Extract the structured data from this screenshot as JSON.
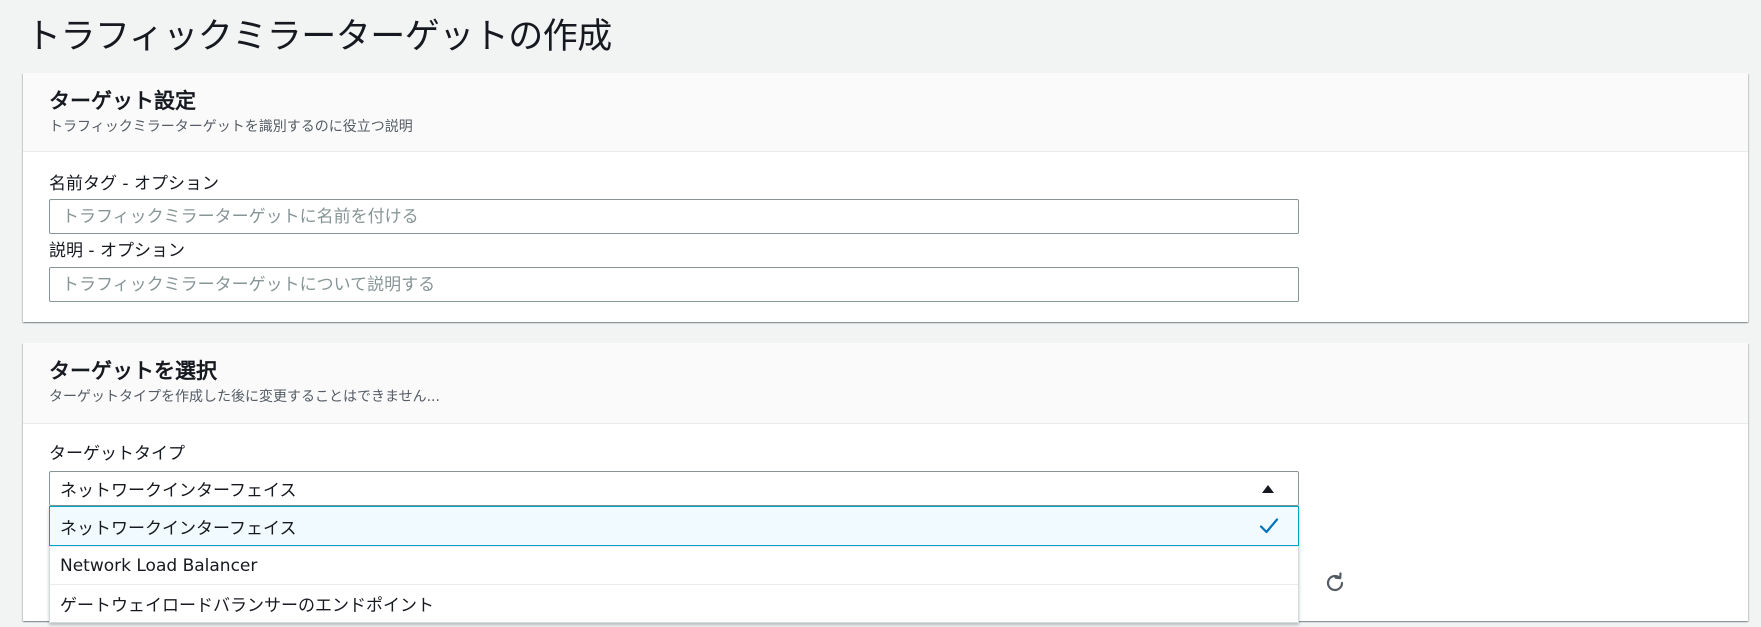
{
  "page": {
    "title": "トラフィックミラーターゲットの作成"
  },
  "target_settings": {
    "title": "ターゲット設定",
    "description": "トラフィックミラーターゲットを識別するのに役立つ説明",
    "name_tag": {
      "label": "名前タグ - オプション",
      "placeholder": "トラフィックミラーターゲットに名前を付ける",
      "value": ""
    },
    "description_field": {
      "label": "説明 - オプション",
      "placeholder": "トラフィックミラーターゲットについて説明する",
      "value": ""
    }
  },
  "select_target": {
    "title": "ターゲットを選択",
    "description": "ターゲットタイプを作成した後に変更することはできません...",
    "target_type": {
      "label": "ターゲットタイプ",
      "selected": "ネットワークインターフェイス",
      "options": [
        {
          "label": "ネットワークインターフェイス",
          "selected": true
        },
        {
          "label": "Network Load Balancer",
          "selected": false
        },
        {
          "label": "ゲートウェイロードバランサーのエンドポイント",
          "selected": false
        }
      ]
    }
  },
  "icons": {
    "check": "check-icon",
    "dropdown_caret": "caret-up-icon",
    "refresh": "refresh-icon"
  },
  "colors": {
    "accent": "#0073bb",
    "selected_bg": "#f1faff",
    "selected_border": "#00a1c9",
    "page_bg": "#f2f3f3"
  }
}
